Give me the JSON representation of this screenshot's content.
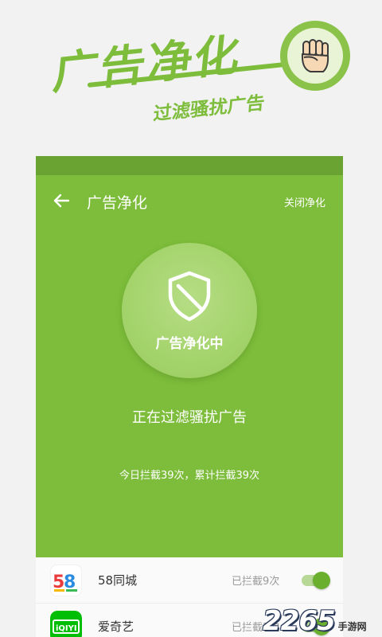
{
  "promo": {
    "title": "广告净化",
    "subtitle": "过滤骚扰广告"
  },
  "toolbar": {
    "title": "广告净化",
    "close_label": "关闭净化"
  },
  "status": {
    "circle_label": "广告净化中",
    "filter_text": "正在过滤骚扰广告",
    "stats_text": "今日拦截39次，累计拦截39次"
  },
  "apps": [
    {
      "name": "58同城",
      "blocked": "已拦截9次",
      "enabled": true,
      "icon": "58-tongcheng-icon"
    },
    {
      "name": "爱奇艺",
      "blocked": "已拦截3次",
      "enabled": true,
      "icon": "iqiyi-icon"
    }
  ],
  "watermark": {
    "number": "2265",
    "site": "手游网"
  },
  "colors": {
    "brand_green": "#7dbd3b",
    "dark_green": "#6aa331",
    "toggle_on": "#6ab02e"
  },
  "icons": {
    "back": "arrow-left-icon",
    "shield": "shield-block-icon",
    "badge": "fist-icon"
  }
}
